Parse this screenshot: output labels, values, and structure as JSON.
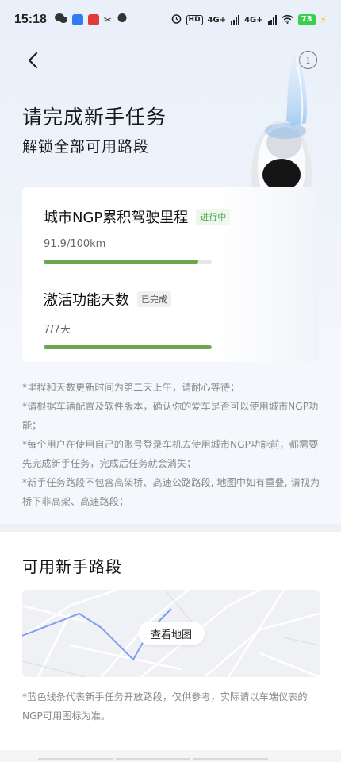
{
  "status_bar": {
    "time": "15:18",
    "hd": "HD",
    "network_1": "4G+",
    "network_2": "4G+",
    "battery": "73"
  },
  "header": {
    "title": "请完成新手任务",
    "subtitle": "解锁全部可用路段",
    "info_symbol": "i"
  },
  "tasks": [
    {
      "title": "城市NGP累积驾驶里程",
      "status": "进行中",
      "value": "91.9/100km",
      "progress": 0.919
    },
    {
      "title": "激活功能天数",
      "status": "已完成",
      "value": "7/7天",
      "progress": 1.0
    }
  ],
  "notes": [
    "*里程和天数更新时间为第二天上午，请耐心等待；",
    "*请根据车辆配置及软件版本，确认你的爱车是否可以使用城市NGP功能；",
    "*每个用户在使用自己的账号登录车机去使用城市NGP功能前，都需要先完成新手任务，完成后任务就会消失；",
    "*新手任务路段不包含高架桥、高速公路路段, 地图中如有重叠, 请视为桥下非高架、高速路段；"
  ],
  "roads": {
    "title": "可用新手路段",
    "map_button": "查看地图",
    "note": "*蓝色线条代表新手任务开放路段，仅供参考，实际请以车端仪表的NGP可用图标为准。"
  },
  "colors": {
    "progress_green": "#6aa84f",
    "badge_progress_text": "#3c9a3c",
    "route_blue": "#7f9ff0"
  }
}
